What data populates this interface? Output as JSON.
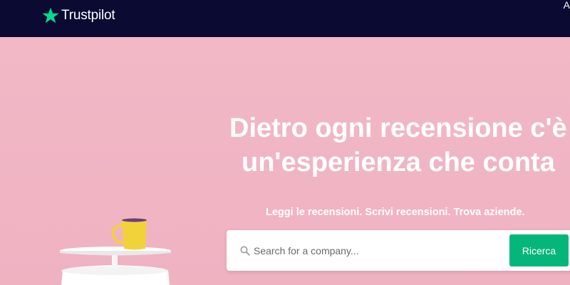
{
  "header": {
    "brand": "Trustpilot",
    "edge_text": "A"
  },
  "hero": {
    "headline_line1": "Dietro ogni recensione c'è",
    "headline_line2": "un'esperienza che conta",
    "subheadline": "Leggi le recensioni. Scrivi recensioni. Trova aziende."
  },
  "search": {
    "placeholder": "Search for a company...",
    "value": "",
    "button_label": "Ricerca",
    "icon": "search-icon"
  },
  "colors": {
    "header_bg": "#0a0a32",
    "hero_bg": "#f0b6c4",
    "brand_green": "#04b67a",
    "mug_yellow": "#f2d23a"
  }
}
